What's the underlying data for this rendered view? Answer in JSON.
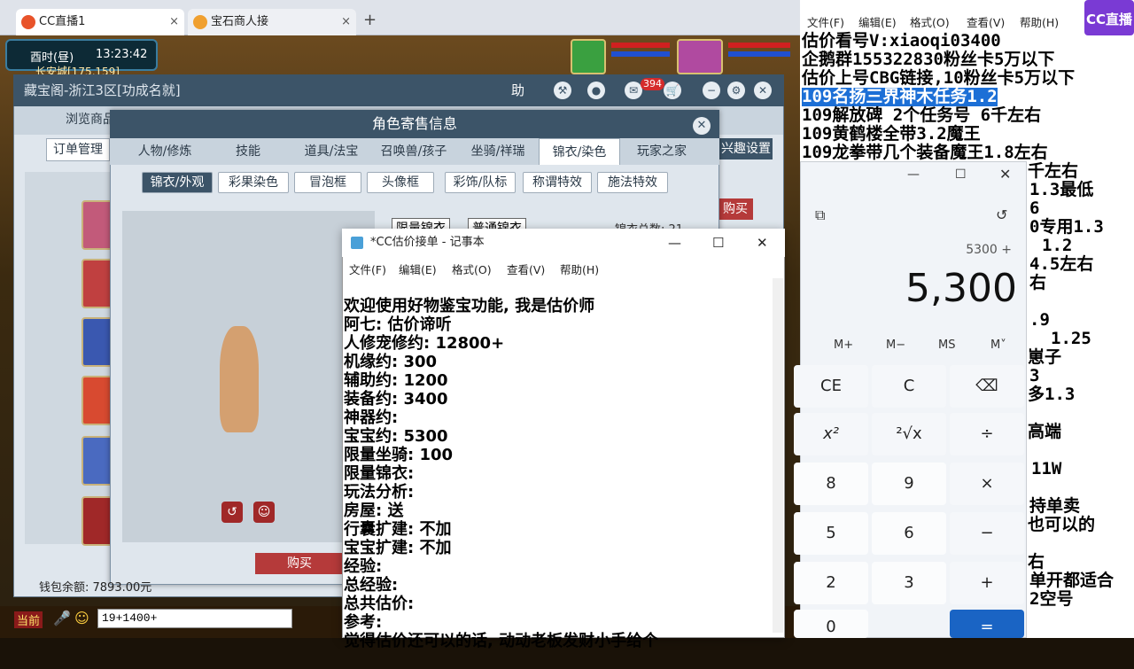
{
  "browser": {
    "tabs": [
      {
        "label": "CC直播1"
      },
      {
        "label": "宝石商人接"
      }
    ],
    "new_tab": "+",
    "tab_close": "×"
  },
  "game": {
    "time": "酉时(昼)",
    "clock": "13:23:42",
    "location": "长安城[175,159]"
  },
  "cbg": {
    "title": "藏宝阁-浙江3区[功成名就]",
    "help": "助",
    "msg_badge": "394",
    "nav": [
      "浏览商品",
      "订单管理"
    ],
    "settings_tab": "兴趣设置",
    "wallet": "钱包余额: 7893.00元"
  },
  "role": {
    "title": "角色寄售信息",
    "tabs": [
      "人物/修炼",
      "技能",
      "道具/法宝",
      "召唤兽/孩子",
      "坐骑/祥瑞",
      "锦衣/染色",
      "玩家之家"
    ],
    "active_tab": 5,
    "subtabs": [
      "锦衣/外观",
      "彩果染色",
      "冒泡框",
      "头像框",
      "彩饰/队标",
      "称谓特效",
      "施法特效"
    ],
    "active_subtab": 0,
    "filters": [
      "限量锦衣",
      "普通锦衣"
    ],
    "count_label": "锦衣总数: 21",
    "buy": "购买",
    "buy_top": "购买"
  },
  "chat": {
    "channel": "当前",
    "input": "19+1400+"
  },
  "notepad": {
    "title": "*CC估价接单 - 记事本",
    "menu": [
      "文件(F)",
      "编辑(E)",
      "格式(O)",
      "查看(V)",
      "帮助(H)"
    ],
    "lines": [
      "欢迎使用好物鉴宝功能, 我是估价师",
      "阿七: 估价谛听",
      "人修宠修约: 12800+",
      "机缘约: 300",
      "辅助约: 1200",
      "装备约: 3400",
      "神器约:",
      "宝宝约: 5300",
      "限量坐骑: 100",
      "限量锦衣:",
      "玩法分析:",
      "房屋: 送",
      "行囊扩建: 不加",
      "宝宝扩建: 不加",
      "经验:",
      "总经验:",
      "总共估价:",
      "参考:",
      "觉得估价还可以的话, 动动老板发财小手给个"
    ]
  },
  "right_note": {
    "menu": [
      "文件(F)",
      "编辑(E)",
      "格式(O)",
      "查看(V)",
      "帮助(H)"
    ],
    "lines": [
      "估价看号V:xiaoqi03400",
      "企鹅群155322830粉丝卡5万以下",
      "估价上号CBG链接,10粉丝卡5万以下",
      "109名扬三界神木任务1.2",
      "109解放碑 2个任务号 6千左右",
      "109黄鹤楼全带3.2魔王",
      "109龙拳带几个装备魔王1.8左右"
    ],
    "partial": [
      "千左右",
      "1.3最低",
      "6",
      "0专用1.3",
      "1.2",
      "4.5左右",
      "右",
      ".9",
      "1.25",
      "崽子",
      "3",
      "多1.3",
      "高端",
      "11W",
      "持单卖",
      "也可以的",
      "右",
      "单开都适合",
      "2空号"
    ],
    "logo": "CC直播"
  },
  "calculator": {
    "expression": "5300 +",
    "display": "5,300",
    "memory": [
      "M+",
      "M−",
      "MS",
      "M˅"
    ],
    "buttons": [
      "CE",
      "C",
      "⌫",
      "x²",
      "²√x",
      "÷",
      "8",
      "9",
      "×",
      "5",
      "6",
      "−",
      "2",
      "3",
      "+",
      "0",
      "="
    ]
  }
}
